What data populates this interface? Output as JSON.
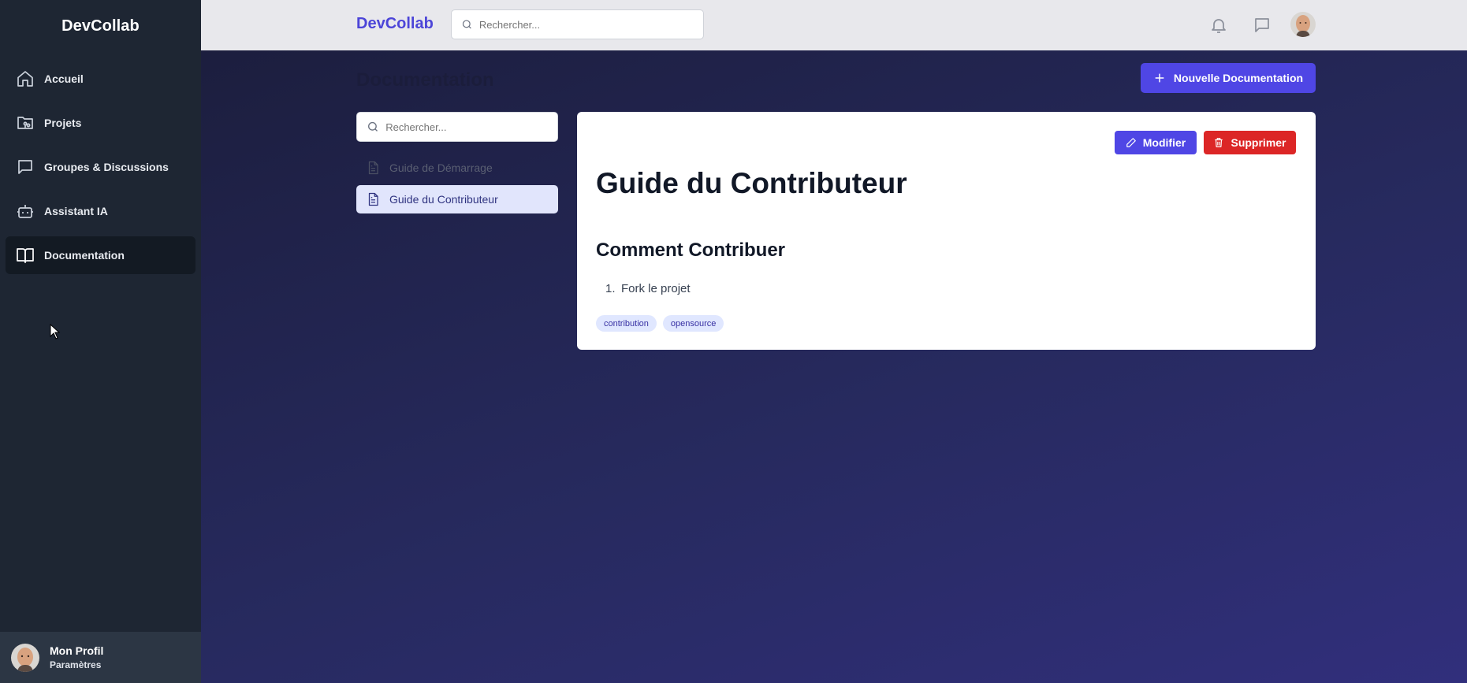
{
  "sidebar": {
    "brand": "DevCollab",
    "items": [
      {
        "label": "Accueil",
        "icon": "home-icon"
      },
      {
        "label": "Projets",
        "icon": "folder-git-icon"
      },
      {
        "label": "Groupes & Discussions",
        "icon": "chat-icon"
      },
      {
        "label": "Assistant IA",
        "icon": "bot-icon"
      },
      {
        "label": "Documentation",
        "icon": "book-open-icon",
        "active": true
      }
    ],
    "profile": {
      "name": "Mon Profil",
      "subtitle": "Paramètres"
    }
  },
  "header": {
    "brand": "DevCollab",
    "search_placeholder": "Rechercher...",
    "icons": [
      "bell-icon",
      "message-icon",
      "user-avatar"
    ]
  },
  "main": {
    "title": "Documentation",
    "new_button": "Nouvelle Documentation",
    "search_placeholder": "Rechercher...",
    "documents": [
      {
        "label": "Guide de Démarrage",
        "active": false
      },
      {
        "label": "Guide du Contributeur",
        "active": true
      }
    ],
    "document": {
      "edit_label": "Modifier",
      "delete_label": "Supprimer",
      "title": "Guide du Contributeur",
      "heading": "Comment Contribuer",
      "list": [
        {
          "num": "1.",
          "text": "Fork le projet"
        }
      ],
      "tags": [
        "contribution",
        "opensource"
      ]
    }
  },
  "colors": {
    "accent": "#4f46e5",
    "danger": "#dc2626",
    "sidebar_bg": "#1e2633"
  }
}
